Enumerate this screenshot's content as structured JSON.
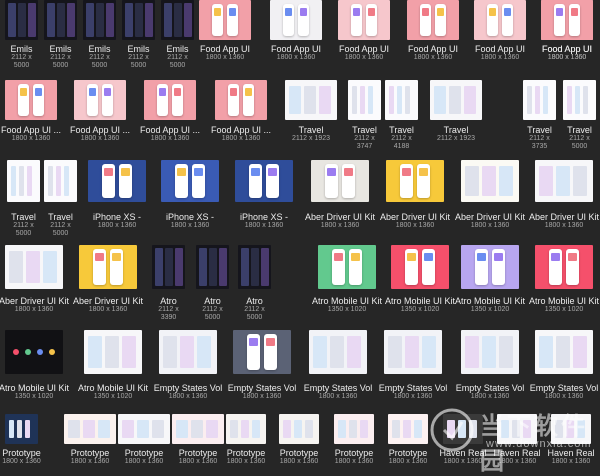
{
  "thumbnails": [
    [
      {
        "title": "Emils",
        "size": "2112 x\n5000",
        "style": "dark-ui"
      },
      {
        "title": "Emils",
        "size": "2112 x\n5000",
        "style": "dark-ui"
      },
      {
        "title": "Emils",
        "size": "2112 x\n5000",
        "style": "dark-ui"
      },
      {
        "title": "Emils",
        "size": "2112 x\n5000",
        "style": "dark-ui"
      },
      {
        "title": "Emils",
        "size": "2112 x\n5000",
        "style": "dark-ui"
      },
      {
        "title": "Food App UI",
        "size": "1800 x 1360",
        "style": "pink"
      },
      {
        "title": "Food App UI",
        "size": "1800 x 1360",
        "style": "light-phones"
      },
      {
        "title": "Food App UI",
        "size": "1800 x 1360",
        "style": "pink-light"
      },
      {
        "title": "Food App UI",
        "size": "1800 x 1360",
        "style": "pink"
      },
      {
        "title": "Food App UI",
        "size": "1800 x 1360",
        "style": "pink-light"
      },
      {
        "title": "Food App UI",
        "size": "1800 x 1360",
        "style": "light-phones"
      },
      {
        "title": "Food App UI",
        "size": "1800 x 1360",
        "style": "pink"
      }
    ],
    [
      {
        "title": "Food App UI ...",
        "size": "1800 x 1360",
        "style": "pink"
      },
      {
        "title": "Food App UI ...",
        "size": "1800 x 1360",
        "style": "pink-light"
      },
      {
        "title": "Food App UI ...",
        "size": "1800 x 1360",
        "style": "pink"
      },
      {
        "title": "Food App UI ...",
        "size": "1800 x 1360",
        "style": "pink"
      },
      {
        "title": "Travel",
        "size": "2112 x 1923",
        "style": "white-doc"
      },
      {
        "title": "Travel",
        "size": "2112 x\n3747",
        "style": "white-tall"
      },
      {
        "title": "Travel",
        "size": "2112 x\n4188",
        "style": "white-tall"
      },
      {
        "title": "Travel",
        "size": "2112 x 1923",
        "style": "white-doc"
      },
      {
        "title": "Travel",
        "size": "2112 x\n3735",
        "style": "white-tall"
      },
      {
        "title": "Travel",
        "size": "2112 x\n5000",
        "style": "white-tall"
      }
    ],
    [
      {
        "title": "Travel",
        "size": "2112 x\n5000",
        "style": "white-tall"
      },
      {
        "title": "Travel",
        "size": "2112 x\n5000",
        "style": "white-tall"
      },
      {
        "title": "iPhone XS -",
        "size": "1800 x 1360",
        "style": "blue"
      },
      {
        "title": "iPhone XS -",
        "size": "1800 x 1360",
        "style": "blue-art"
      },
      {
        "title": "iPhone XS -",
        "size": "1800 x 1360",
        "style": "blue"
      },
      {
        "title": "Aber Driver UI Kit",
        "size": "1800 x 1360",
        "style": "grid-phones"
      },
      {
        "title": "Aber Driver UI Kit",
        "size": "1800 x 1360",
        "style": "yellow"
      },
      {
        "title": "Aber Driver UI Kit",
        "size": "1800 x 1360",
        "style": "white-yellow"
      },
      {
        "title": "Aber Driver UI Kit",
        "size": "1800 x 1360",
        "style": "white-doc"
      }
    ],
    [
      {
        "title": "Aber Driver UI Kit",
        "size": "1800 x 1360",
        "style": "white-doc"
      },
      {
        "title": "Aber Driver UI Kit",
        "size": "1800 x 1360",
        "style": "yellow"
      },
      {
        "title": "Atro",
        "size": "2112 x\n3390",
        "style": "dark-ui"
      },
      {
        "title": "Atro",
        "size": "2112 x\n5000",
        "style": "dark-ui"
      },
      {
        "title": "Atro",
        "size": "2112 x\n5000",
        "style": "dark-ui"
      },
      {
        "title": "Atro Mobile UI Kit",
        "size": "1350 x 1020",
        "style": "green"
      },
      {
        "title": "Atro Mobile UI Kit",
        "size": "1350 x 1020",
        "style": "pink-red"
      },
      {
        "title": "Atro Mobile UI Kit",
        "size": "1350 x 1020",
        "style": "purple-grad"
      },
      {
        "title": "Atro Mobile UI Kit",
        "size": "1350 x 1020",
        "style": "pink-red"
      },
      {
        "title": "Atro Mobile UI Kit",
        "size": "1350 x 1020",
        "style": "white-dots"
      }
    ],
    [
      {
        "title": "Atro Mobile UI Kit",
        "size": "1350 x 1020",
        "style": "black-dots"
      },
      {
        "title": "Atro Mobile UI Kit",
        "size": "1350 x 1020",
        "style": "white-doc"
      },
      {
        "title": "Empty States Vol",
        "size": "1800 x 1360",
        "style": "white-light"
      },
      {
        "title": "Empty States Vol",
        "size": "1800 x 1360",
        "style": "slate"
      },
      {
        "title": "Empty States Vol",
        "size": "1800 x 1360",
        "style": "white-light"
      },
      {
        "title": "Empty States Vol",
        "size": "1800 x 1360",
        "style": "white-light"
      },
      {
        "title": "Empty States Vol",
        "size": "1800 x 1360",
        "style": "white-light"
      },
      {
        "title": "Empty States Vol",
        "size": "1800 x 1360",
        "style": "white-doc"
      }
    ],
    [
      {
        "title": "Prototype",
        "size": "1800 x 1360",
        "style": "dark-blue"
      },
      {
        "title": "Prototype",
        "size": "1800 x 1360",
        "style": "white-orange"
      },
      {
        "title": "Prototype",
        "size": "1800 x 1360",
        "style": "white-doc"
      },
      {
        "title": "Prototype",
        "size": "1800 x 1360",
        "style": "white-pink"
      },
      {
        "title": "Prototype",
        "size": "1800 x 1360",
        "style": "white-grid"
      },
      {
        "title": "Prototype",
        "size": "1800 x 1360",
        "style": "white-grid"
      },
      {
        "title": "Prototype",
        "size": "1800 x 1360",
        "style": "white-pink"
      },
      {
        "title": "Prototype",
        "size": "1800 x 1360",
        "style": "white-red"
      },
      {
        "title": "Haven Real",
        "size": "1800 x 1360",
        "style": "dark-photo"
      },
      {
        "title": "Haven Real",
        "size": "1800 x 1360",
        "style": "white-doc"
      },
      {
        "title": "Haven Real",
        "size": "1800 x 1360",
        "style": "white-doc"
      }
    ]
  ],
  "watermark": {
    "text_main": "当下软件园",
    "text_url": "www.downxia.com"
  }
}
